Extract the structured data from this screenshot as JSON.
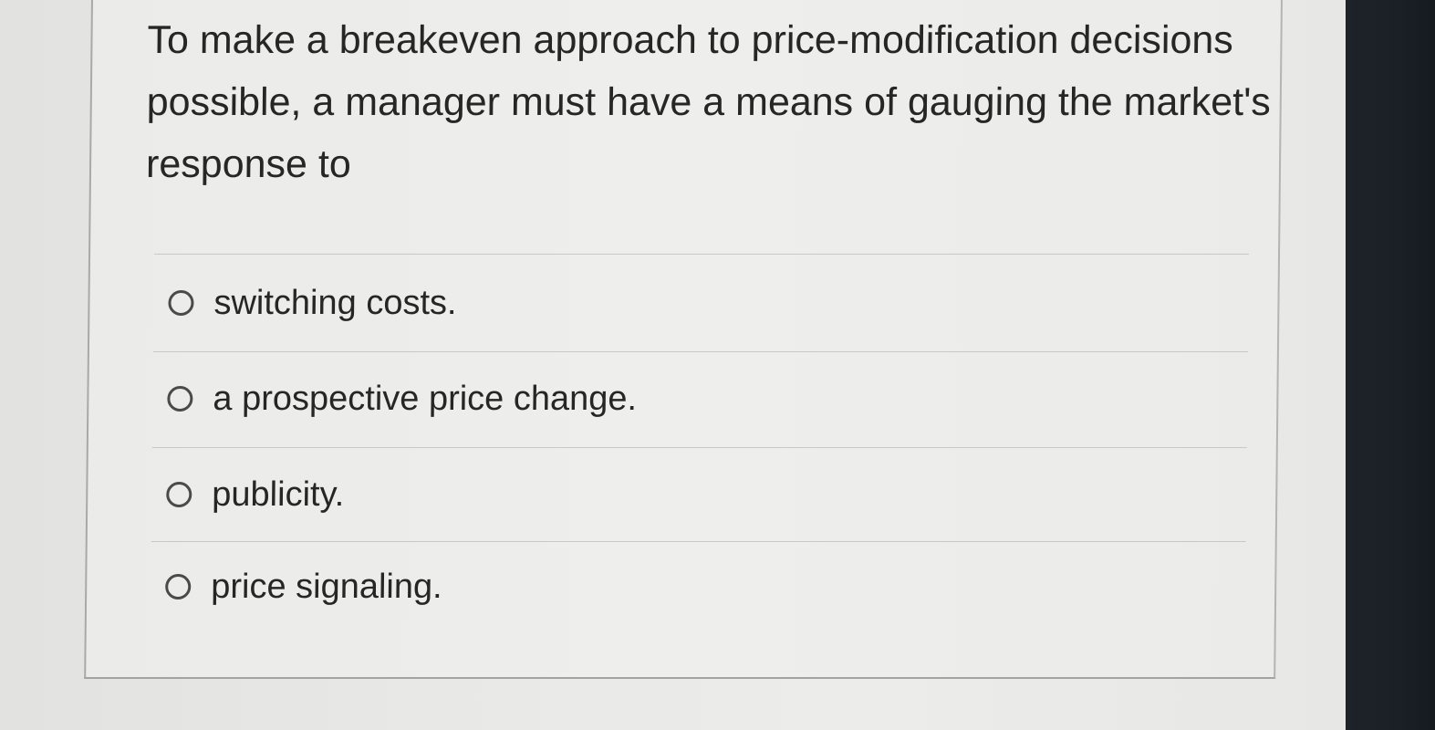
{
  "question": {
    "text": "To make a breakeven approach to price-modification decisions possible, a manager must have a means of gauging the market's response to"
  },
  "options": [
    {
      "label": "switching costs."
    },
    {
      "label": "a prospective price change."
    },
    {
      "label": "publicity."
    },
    {
      "label": "price signaling."
    }
  ]
}
